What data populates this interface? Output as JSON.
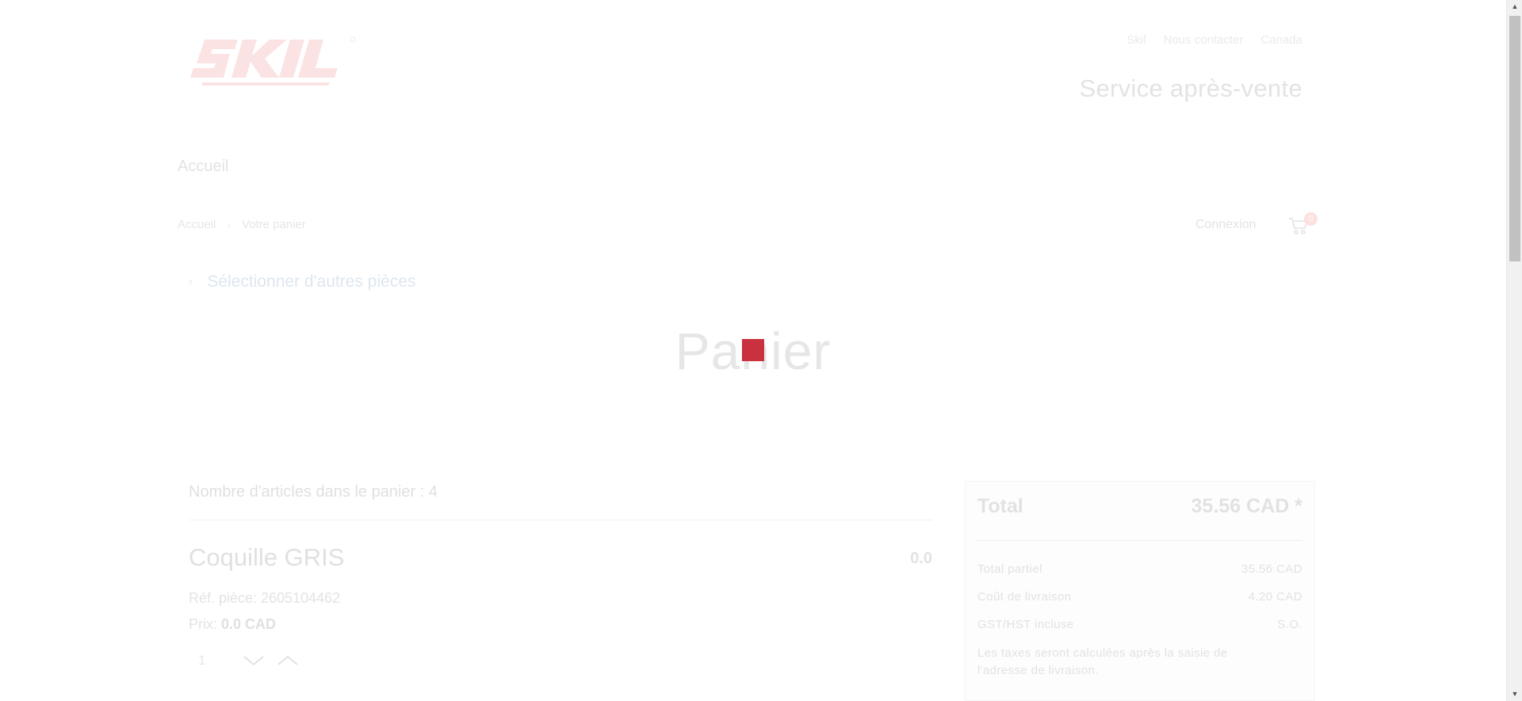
{
  "header": {
    "logo_text": "SKIL",
    "top_links": [
      "Skil",
      "Nous contacter",
      "Canada"
    ],
    "service_title": "Service après-vente",
    "nav_home": "Accueil"
  },
  "breadcrumb": {
    "items": [
      "Accueil",
      "Votre panier"
    ]
  },
  "account": {
    "login_label": "Connexion",
    "cart_count": "0"
  },
  "back_link_label": "Sélectionner d'autres pièces",
  "page_title": "Panier",
  "cart": {
    "items_count_label": "Nombre d'articles dans le panier : 4",
    "items": [
      {
        "name": "Coquille GRIS",
        "amount": "0.0",
        "ref": "Réf. pièce: 2605104462",
        "price_label": "Prix:",
        "price_value": "0.0 CAD",
        "quantity": "1"
      }
    ]
  },
  "summary": {
    "total_label": "Total",
    "total_value": "35.56 CAD *",
    "subtotal_label": "Total partiel",
    "subtotal_value": "35.56 CAD",
    "shipping_label": "Coût de livraison",
    "shipping_value": "4.20 CAD",
    "tax_label": "GST/HST incluse",
    "tax_value": "S.O.",
    "note": "Les taxes seront calculées après la saisie de l'adresse de livraison."
  },
  "colors": {
    "loader": "#c8313d",
    "badge": "#fde0e0"
  },
  "icons": [
    "cart-icon",
    "chevron-right-icon",
    "chevron-left-icon",
    "chevron-down-icon",
    "chevron-up-icon"
  ]
}
